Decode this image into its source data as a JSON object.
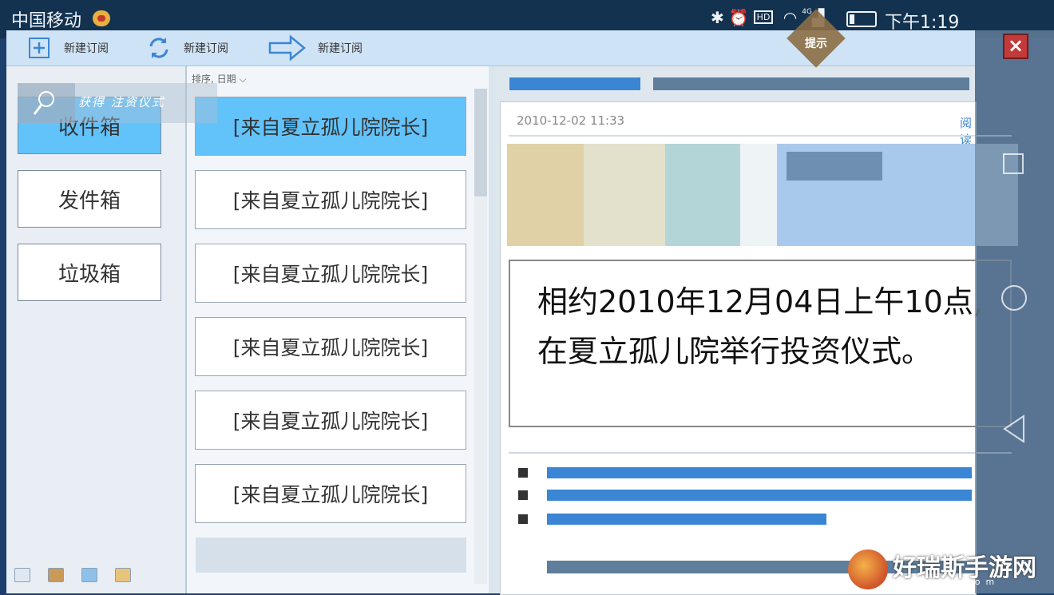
{
  "status_bar": {
    "carrier": "中国移动",
    "network": "4G",
    "hd": "HD",
    "time": "下午1:19"
  },
  "toolbar": {
    "items": [
      {
        "label": "新建订阅",
        "icon": "add-icon"
      },
      {
        "label": "新建订阅",
        "icon": "refresh-icon"
      },
      {
        "label": "新建订阅",
        "icon": "arrow-right-icon"
      }
    ]
  },
  "overlay_hint": {
    "label": "提示"
  },
  "search_overlay": {
    "title": "获得 注资仪式"
  },
  "folders": [
    {
      "label": "收件箱",
      "active": true
    },
    {
      "label": "发件箱",
      "active": false
    },
    {
      "label": "垃圾箱",
      "active": false
    }
  ],
  "message_list": {
    "sort_label": "排序, 日期",
    "items": [
      {
        "subject": "[来自夏立孤儿院院长]",
        "active": true
      },
      {
        "subject": "[来自夏立孤儿院院长]",
        "active": false
      },
      {
        "subject": "[来自夏立孤儿院院长]",
        "active": false
      },
      {
        "subject": "[来自夏立孤儿院院长]",
        "active": false
      },
      {
        "subject": "[来自夏立孤儿院院长]",
        "active": false
      },
      {
        "subject": "[来自夏立孤儿院院长]",
        "active": false
      }
    ]
  },
  "reader": {
    "date": "2010-12-02  11:33",
    "read_original": "阅读原文",
    "body_line1": "相约2010年12月04日上午10点,",
    "body_line2": "在夏立孤儿院举行投资仪式。"
  },
  "watermark": {
    "name": "好瑞斯手游网",
    "domain": "horhys.com"
  },
  "colors": {
    "accent_blue": "#3b86d4",
    "selected_item": "#62c3fb",
    "banner": [
      "#e0d2a6",
      "#e3e1cb",
      "#b4d5d7",
      "#eef3f6",
      "#a8c9ec"
    ]
  }
}
